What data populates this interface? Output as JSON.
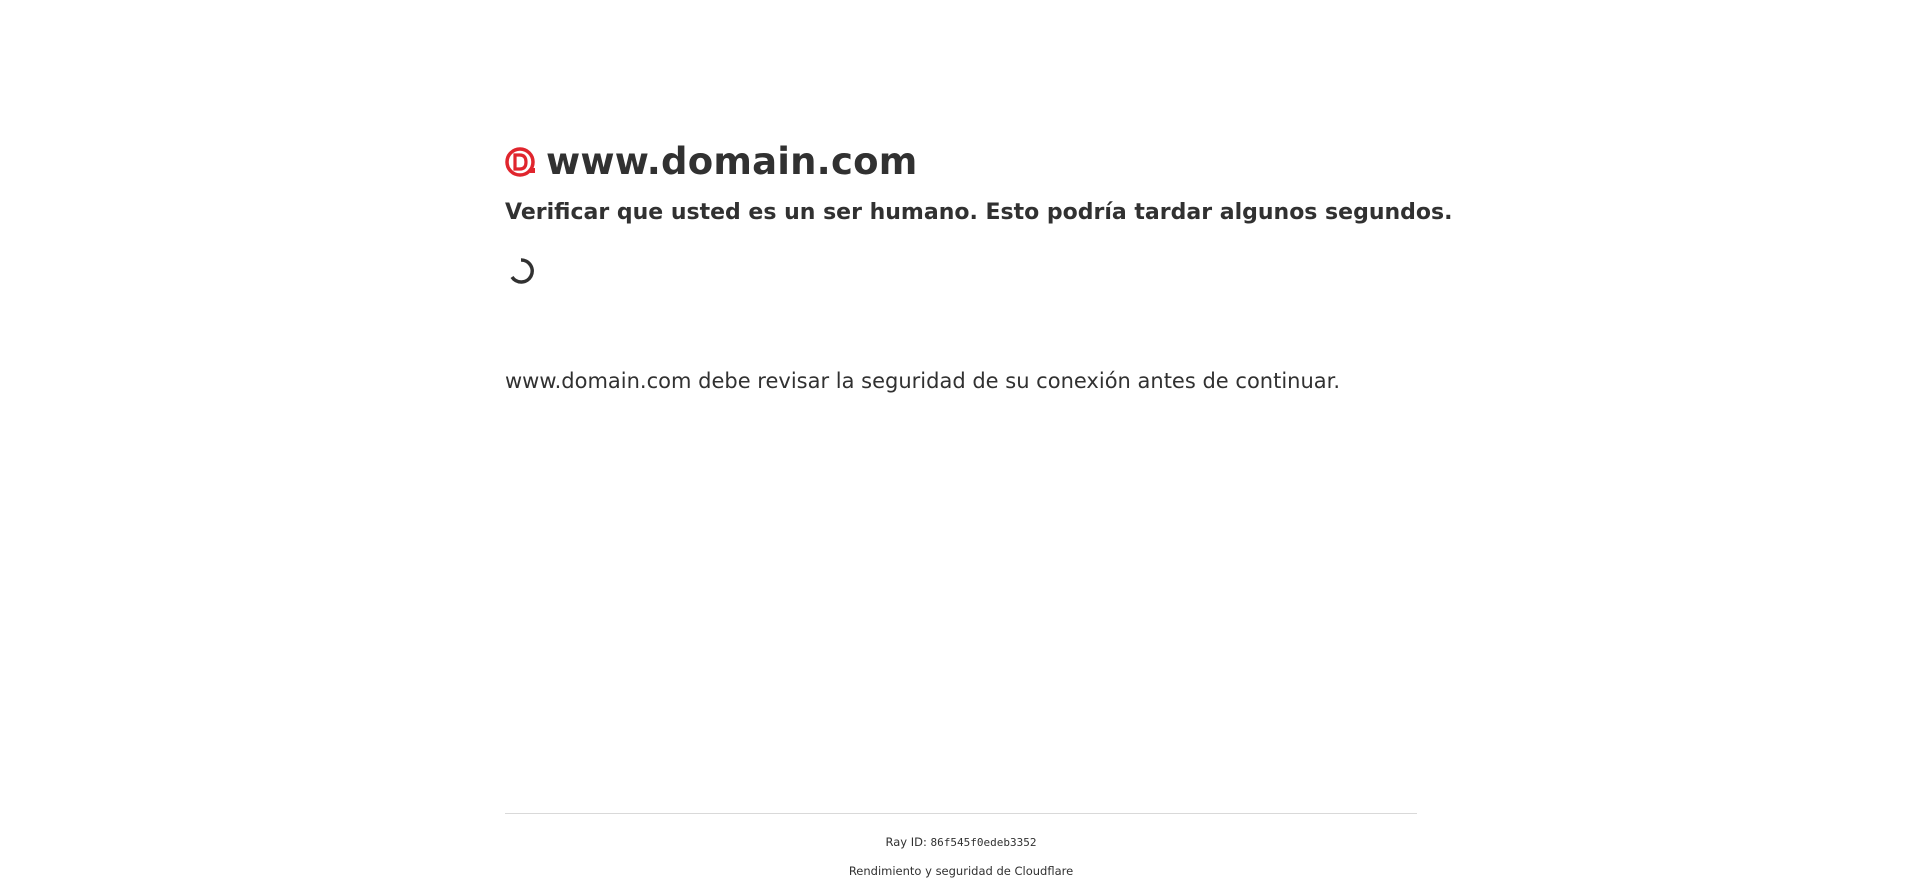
{
  "header": {
    "site_name": "www.domain.com",
    "favicon_icon": "domain-favicon-icon",
    "favicon_color": "#e0252d"
  },
  "challenge": {
    "headline": "Verificar que usted es un ser humano. Esto podría tardar algunos segundos.",
    "spinner_icon": "loading-spinner-icon",
    "info_text": "www.domain.com debe revisar la seguridad de su conexión antes de continuar."
  },
  "footer": {
    "ray_label": "Ray ID:",
    "ray_id": "86f545f0edeb3352",
    "performance_text": "Rendimiento y seguridad de Cloudflare"
  }
}
